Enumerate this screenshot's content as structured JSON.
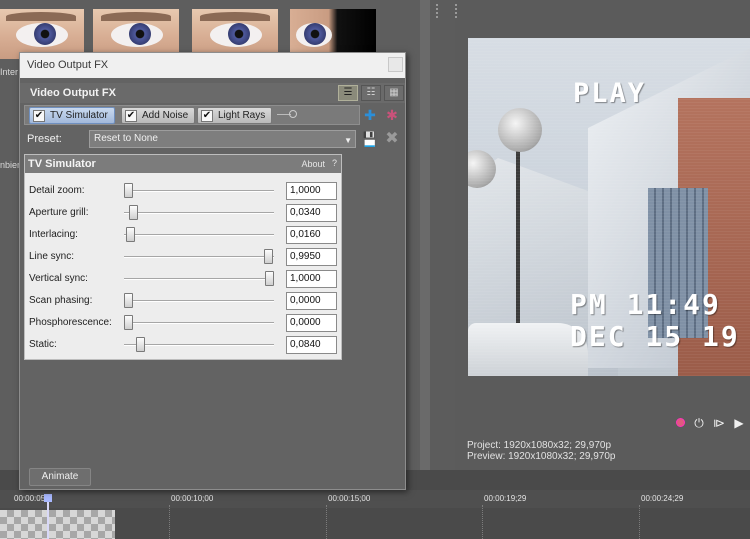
{
  "media_panel": {
    "labels": [
      "Inter",
      "nbier"
    ]
  },
  "preview": {
    "overlay": {
      "status": "PLAY",
      "time": "PM 11:49",
      "date": "DEC 15 19"
    },
    "info": {
      "project": "Project:   1920x1080x32; 29,970p",
      "preview": "Preview:  1920x1080x32; 29,970p"
    }
  },
  "dialog": {
    "title": "Video Output FX",
    "header_title": "Video Output FX",
    "chain": [
      {
        "label": "TV Simulator",
        "checked": true,
        "active": true
      },
      {
        "label": "Add Noise",
        "checked": true,
        "active": false
      },
      {
        "label": "Light Rays",
        "checked": true,
        "active": false
      }
    ],
    "preset_label": "Preset:",
    "preset_value": "Reset to None",
    "plugin": {
      "name": "TV Simulator",
      "about": "About",
      "help": "?",
      "params": [
        {
          "label": "Detail zoom:",
          "value": "1,0000",
          "level": 0.0
        },
        {
          "label": "Aperture grill:",
          "value": "0,0340",
          "level": 0.034
        },
        {
          "label": "Interlacing:",
          "value": "0,0160",
          "level": 0.016
        },
        {
          "label": "Line sync:",
          "value": "0,9950",
          "level": 0.995
        },
        {
          "label": "Vertical sync:",
          "value": "1,0000",
          "level": 1.0
        },
        {
          "label": "Scan phasing:",
          "value": "0,0000",
          "level": 0.0
        },
        {
          "label": "Phosphorescence:",
          "value": "0,0000",
          "level": 0.0
        },
        {
          "label": "Static:",
          "value": "0,0840",
          "level": 0.084
        }
      ]
    },
    "animate_label": "Animate"
  },
  "timeline": {
    "ticks": [
      "00:00:05",
      "00:00:10;00",
      "00:00:15;00",
      "00:00:19;29",
      "00:00:24;29"
    ]
  }
}
